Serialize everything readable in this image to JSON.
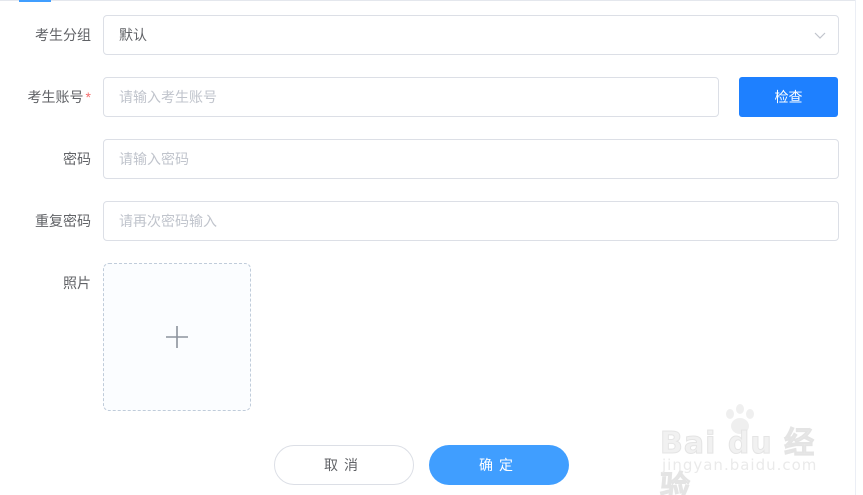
{
  "form": {
    "group": {
      "label": "考生分组",
      "value": "默认"
    },
    "account": {
      "label": "考生账号",
      "required_mark": "*",
      "placeholder": "请输入考生账号",
      "check_button": "检查"
    },
    "password": {
      "label": "密码",
      "placeholder": "请输入密码"
    },
    "repeat_password": {
      "label": "重复密码",
      "placeholder": "请再次密码输入"
    },
    "photo": {
      "label": "照片"
    }
  },
  "actions": {
    "cancel": "取消",
    "confirm": "确定"
  },
  "watermark": {
    "brand": "Bai du 经验",
    "url": "jingyan.baidu.com"
  },
  "colors": {
    "primary": "#409eff",
    "check_button": "#1e80ff",
    "required": "#f56c6c",
    "border": "#dcdfe6"
  },
  "icons": {
    "select_arrow": "chevron-down-icon",
    "upload": "plus-icon"
  }
}
